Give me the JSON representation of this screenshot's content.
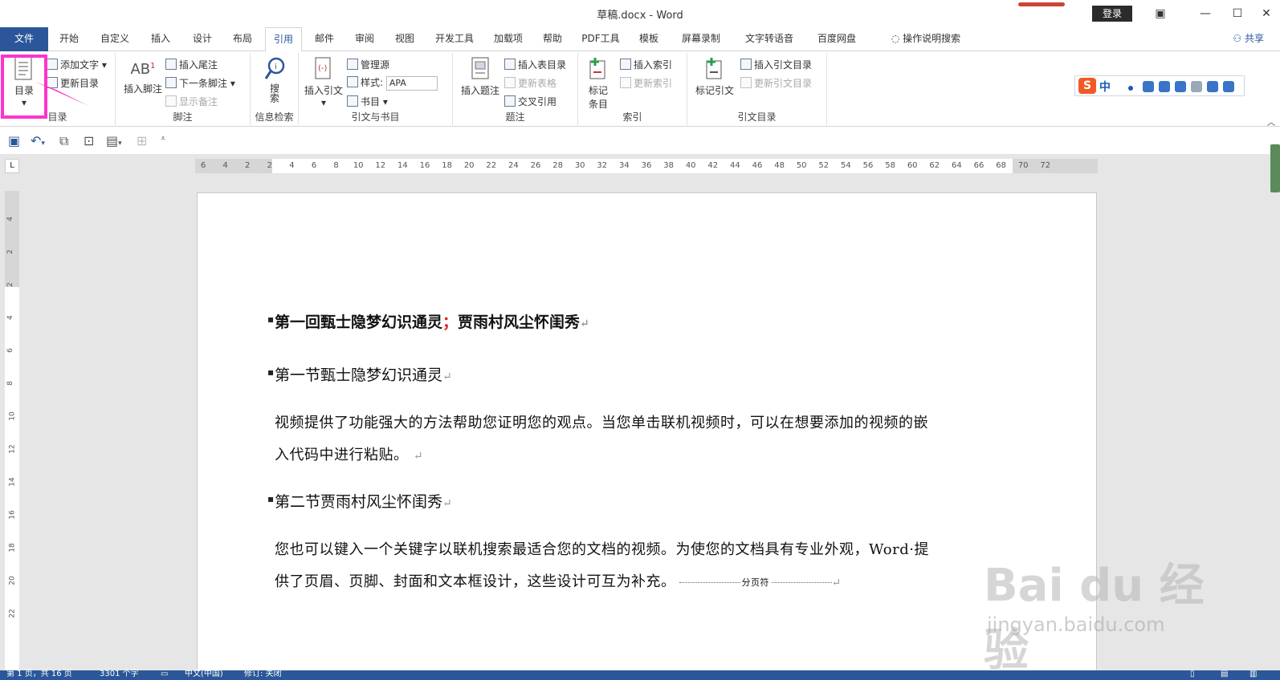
{
  "window": {
    "title": "草稿.docx - Word",
    "login": "登录"
  },
  "tabs": [
    "文件",
    "开始",
    "自定义",
    "插入",
    "设计",
    "布局",
    "引用",
    "邮件",
    "审阅",
    "视图",
    "开发工具",
    "加载项",
    "帮助",
    "PDF工具",
    "模板",
    "屏幕录制",
    "文字转语音",
    "百度网盘",
    "操作说明搜索"
  ],
  "share": "共享",
  "ribbon": {
    "toc": {
      "big": "目录",
      "add_text": "添加文字",
      "update": "更新目录",
      "label": "目录"
    },
    "footnote": {
      "insert": "插入脚注",
      "ab": "AB",
      "endnote": "插入尾注",
      "next": "下一条脚注",
      "show": "显示备注",
      "label": "脚注"
    },
    "research": {
      "search": "搜索",
      "label": "信息检索"
    },
    "citation": {
      "insert": "插入引文",
      "manage": "管理源",
      "style_label": "样式:",
      "style_value": "APA",
      "biblio": "书目",
      "label": "引文与书目"
    },
    "caption": {
      "insert": "插入题注",
      "table_of_figures": "插入表目录",
      "update_table": "更新表格",
      "cross_ref": "交叉引用",
      "label": "题注"
    },
    "index": {
      "mark": "标记条目",
      "insert": "插入索引",
      "update": "更新索引",
      "label": "索引"
    },
    "authorities": {
      "mark": "标记引文",
      "insert": "插入引文目录",
      "update": "更新引文目录",
      "label": "引文目录"
    }
  },
  "ime": {
    "lang": "中"
  },
  "ruler_ticks": [
    "6",
    "4",
    "2",
    "2",
    "4",
    "6",
    "8",
    "10",
    "12",
    "14",
    "16",
    "18",
    "20",
    "22",
    "24",
    "26",
    "28",
    "30",
    "32",
    "34",
    "36",
    "38",
    "40",
    "42",
    "44",
    "46",
    "48",
    "50",
    "52",
    "54",
    "56",
    "58",
    "60",
    "62",
    "64",
    "66",
    "68",
    "70",
    "72"
  ],
  "vruler_ticks": [
    "4",
    "2",
    "2",
    "4",
    "6",
    "8",
    "10",
    "12",
    "14",
    "16",
    "18",
    "20",
    "22"
  ],
  "document": {
    "heading1_a": "第一回甄士隐梦幻识通灵",
    "heading1_sep": "；",
    "heading1_b": "贾雨村风尘怀闺秀",
    "heading2_1": "第一节甄士隐梦幻识通灵",
    "para1_line1": "视频提供了功能强大的方法帮助您证明您的观点。当您单击联机视频时，可以在想要添加的视频的嵌",
    "para1_line2": "入代码中进行粘贴。",
    "heading2_2": "第二节贾雨村风尘怀闺秀",
    "para2_line1": "您也可以键入一个关键字以联机搜索最适合您的文档的视频。为使您的文档具有专业外观，Word·提",
    "para2_line2": "供了页眉、页脚、封面和文本框设计，这些设计可互为补充。",
    "page_break": "分页符",
    "para_mark": "↵"
  },
  "watermark": {
    "main": "Bai du 经验",
    "sub": "jingyan.baidu.com"
  },
  "status": {
    "page": "第 1 页，共 16 页",
    "words": "3301 个字",
    "lang": "中文(中国)",
    "track": "修订: 关闭"
  },
  "colors": {
    "accent": "#2b579a",
    "highlight": "#ff33cc",
    "separator": "#e02020"
  }
}
